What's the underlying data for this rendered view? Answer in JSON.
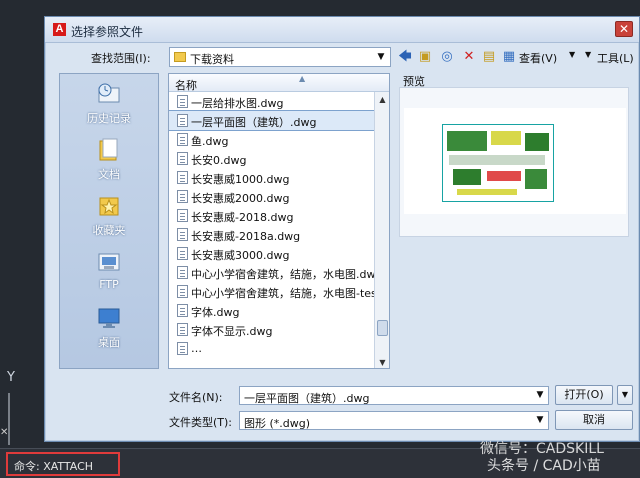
{
  "dialog": {
    "title": "选择参照文件",
    "close_glyph": "✕",
    "lookin_label": "查找范围(I):",
    "lookin_value": "下载资料",
    "toolbar": {
      "view_label": "查看(V)",
      "tools_label": "工具(L)"
    },
    "places": [
      {
        "label": "历史记录",
        "icon": "history-icon"
      },
      {
        "label": "文档",
        "icon": "documents-icon"
      },
      {
        "label": "收藏夹",
        "icon": "favorites-icon"
      },
      {
        "label": "FTP",
        "icon": "ftp-icon"
      },
      {
        "label": "桌面",
        "icon": "desktop-icon"
      }
    ],
    "list_header": "名称",
    "files": [
      "一层给排水图.dwg",
      "一层平面图（建筑）.dwg",
      "鱼.dwg",
      "长安0.dwg",
      "长安惠威1000.dwg",
      "长安惠威2000.dwg",
      "长安惠威-2018.dwg",
      "长安惠威-2018a.dwg",
      "长安惠威3000.dwg",
      "中心小学宿舍建筑，结施，水电图.dw",
      "中心小学宿舍建筑，结施，水电图-tes",
      "字体.dwg",
      "字体不显示.dwg",
      "…"
    ],
    "selected_index": 1,
    "preview_label": "预览",
    "filename_label": "文件名(N):",
    "filename_value": "一层平面图（建筑）.dwg",
    "filetype_label": "文件类型(T):",
    "filetype_value": "图形 (*.dwg)",
    "open_button": "打开(O)",
    "cancel_button": "取消"
  },
  "command": {
    "text": "命令: XATTACH"
  },
  "axis_label": "Y",
  "watermark": {
    "line1": "微信号：CADSKILL",
    "line2": "头条号 / CAD小苗"
  },
  "colors": {
    "dialog_bg": "#d9e4f1",
    "highlight": "#e03b3b",
    "logo": "#d71a1a"
  }
}
